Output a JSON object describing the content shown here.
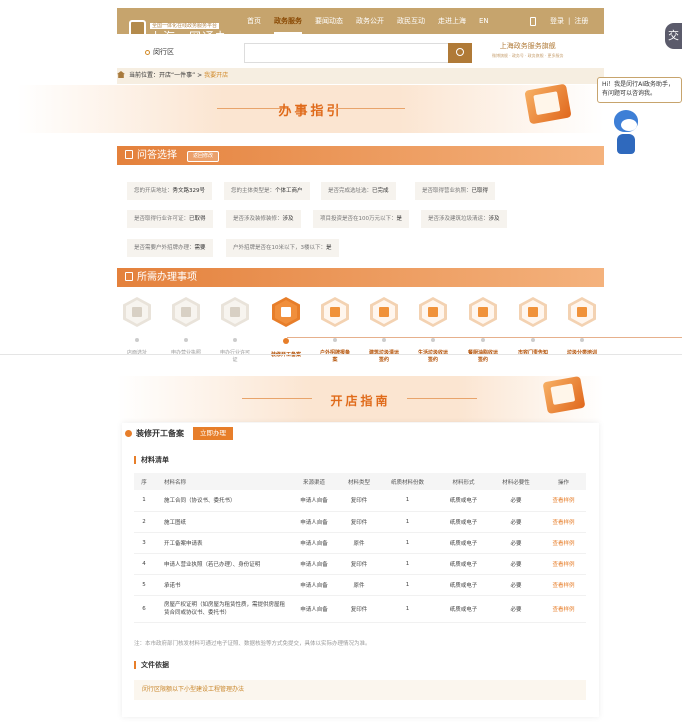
{
  "header": {
    "logo_sub": "全国一体化在线政务服务平台",
    "logo_title": "上海一网通办",
    "nav": [
      "首页",
      "政务服务",
      "要闻动态",
      "政务公开",
      "政民互动",
      "走进上海",
      "EN"
    ],
    "login": "登录",
    "separator": "|",
    "register": "注册"
  },
  "search": {
    "location": "闵行区",
    "brand_title": "上海政务服务旗舰",
    "brand_sub": "微博旗舰 · 政务号 · 政务旗舰 · 更多服务"
  },
  "breadcrumb": {
    "prefix": "当前位置：",
    "path": "开店“一件事”",
    "sep": ">",
    "current": "我要开店"
  },
  "banner": {
    "title": "办事指引"
  },
  "chat": {
    "text": "Hi！我是闵行AI政务助手，有问题可以咨询我。"
  },
  "side_button": {
    "label": "交"
  },
  "qa": {
    "title": "问答选择",
    "reselect": "返回修改",
    "chips": [
      {
        "label": "您的开店地址：",
        "value": "秀文路329号"
      },
      {
        "label": "您的主体类型是：",
        "value": "个体工商户"
      },
      {
        "label": "是否完成选址选：",
        "value": "已完成"
      },
      {
        "label": "是否取得营业执照：",
        "value": "已取得"
      },
      {
        "label": "是否取得行业许可证：",
        "value": "已取得"
      },
      {
        "label": "是否涉及装修装修：",
        "value": "涉及"
      },
      {
        "label": "项目投资是否在100万元以下：",
        "value": "是"
      },
      {
        "label": "是否涉及建筑垃圾清运：",
        "value": "涉及"
      },
      {
        "label": "是否需要户外招牌办理：",
        "value": "需要"
      },
      {
        "label": "户外招牌是否在10米以下，3楼以下：",
        "value": "是"
      }
    ]
  },
  "items_section": {
    "title": "所需办理事项"
  },
  "steps": [
    {
      "label": "店面选址",
      "state": "done",
      "icon": "shop-icon"
    },
    {
      "label": "申办营业执照",
      "state": "done",
      "icon": "license-icon"
    },
    {
      "label": "申办行业许可证",
      "state": "done",
      "icon": "permit-icon"
    },
    {
      "label": "装修开工备案",
      "state": "current",
      "icon": "paint-roller-icon"
    },
    {
      "label": "户外招牌报备案",
      "state": "next",
      "icon": "signboard-icon"
    },
    {
      "label": "建筑垃圾清运签约",
      "state": "next",
      "icon": "truck-icon"
    },
    {
      "label": "生活垃圾收运签约",
      "state": "next",
      "icon": "trash-icon"
    },
    {
      "label": "餐厨油脂收运签约",
      "state": "next",
      "icon": "oil-icon"
    },
    {
      "label": "市容门责告知",
      "state": "next",
      "icon": "notice-icon"
    },
    {
      "label": "垃圾分类培训",
      "state": "next",
      "icon": "recycle-icon"
    }
  ],
  "guide_banner": {
    "title": "开店指南"
  },
  "card": {
    "title": "装修开工备案",
    "apply": "立即办理",
    "materials_title": "材料清单",
    "columns": [
      "序",
      "材料名称",
      "来源渠道",
      "材料类型",
      "纸质材料份数",
      "材料形式",
      "材料必要性",
      "操作"
    ],
    "rows": [
      [
        "1",
        "施工合同（协议书、委托书）",
        "申请人自备",
        "复印件",
        "1",
        "纸质或电子",
        "必要",
        "查看样例"
      ],
      [
        "2",
        "施工图纸",
        "申请人自备",
        "复印件",
        "1",
        "纸质或电子",
        "必要",
        "查看样例"
      ],
      [
        "3",
        "开工备案申请表",
        "申请人自备",
        "原件",
        "1",
        "纸质或电子",
        "必要",
        "查看样例"
      ],
      [
        "4",
        "申请人营业执照（若已办理）、身份证明",
        "申请人自备",
        "复印件",
        "1",
        "纸质或电子",
        "必要",
        "查看样例"
      ],
      [
        "5",
        "承诺书",
        "申请人自备",
        "原件",
        "1",
        "纸质或电子",
        "必要",
        "查看样例"
      ],
      [
        "6",
        "房屋产权证明（如房屋为租赁性质，需提供房屋租赁合同或协议书、委托书）",
        "申请人自备",
        "复印件",
        "1",
        "纸质或电子",
        "必要",
        "查看样例"
      ]
    ],
    "note": "注：本市政府部门核发材料可通过电子证照、数据核验等方式免提交，具体以实际办理情况为准。",
    "basis_title": "文件依据",
    "basis_text": "闵行区限额以下小型建设工程管理办法"
  },
  "colors": {
    "accent": "#e77e2a",
    "brand": "#c6a46d"
  }
}
